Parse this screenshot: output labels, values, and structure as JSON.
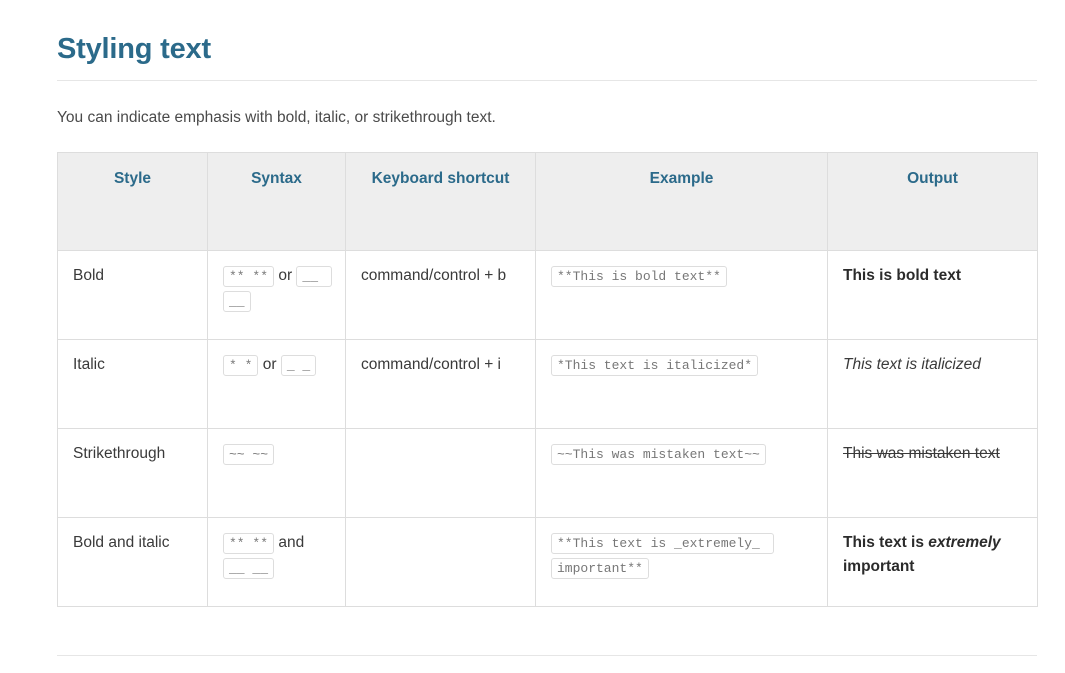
{
  "page": {
    "title": "Styling text",
    "intro": "You can indicate emphasis with bold, italic, or strikethrough text.",
    "accent_color": "#2b6a8a",
    "header_bg": "#eeeeee",
    "border_color": "#dddddd",
    "code_text_color": "#777777"
  },
  "table": {
    "headers": [
      "Style",
      "Syntax",
      "Keyboard shortcut",
      "Example",
      "Output"
    ],
    "rows": [
      {
        "style": "Bold",
        "syntax": {
          "code_1": "** **",
          "joiner": " or ",
          "code_2": "__ __"
        },
        "shortcut": "command/control + b",
        "example": "**This is bold text**",
        "output": {
          "segments": [
            {
              "text": "This is bold text",
              "format": "bold"
            }
          ]
        }
      },
      {
        "style": "Italic",
        "syntax": {
          "code_1": "* *",
          "joiner": " or ",
          "code_2": "_ _"
        },
        "shortcut": "command/control + i",
        "example": "*This text is italicized*",
        "output": {
          "segments": [
            {
              "text": "This text is italicized",
              "format": "italic"
            }
          ]
        }
      },
      {
        "style": "Strikethrough",
        "syntax": {
          "code_1": "~~ ~~",
          "joiner": "",
          "code_2": ""
        },
        "shortcut": "",
        "example": "~~This was mistaken text~~",
        "output": {
          "segments": [
            {
              "text": "This was mistaken text",
              "format": "strikethrough"
            }
          ]
        }
      },
      {
        "style": "Bold and italic",
        "syntax": {
          "code_1": "** **",
          "joiner": " and ",
          "code_2": "__ __"
        },
        "shortcut": "",
        "example": "**This text is _extremely_ important**",
        "output": {
          "segments": [
            {
              "text": "This text is ",
              "format": "bold"
            },
            {
              "text": "extremely",
              "format": "bolditalic"
            },
            {
              "text": " important",
              "format": "bold"
            }
          ]
        }
      }
    ]
  }
}
